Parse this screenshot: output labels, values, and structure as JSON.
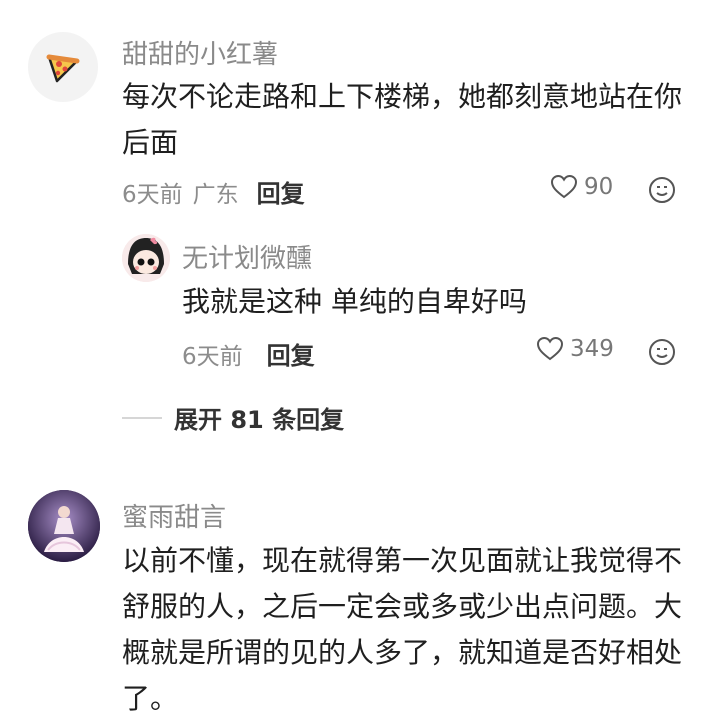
{
  "comments": [
    {
      "author": "甜甜的小红薯",
      "avatar_icon": "pizza-slice-icon",
      "text_lines": [
        "每次不论走路和上下楼梯，她都刻意地站在你",
        "后面"
      ],
      "time": "6天前",
      "location": "广东",
      "reply_label": "回复",
      "likes": "90",
      "reply": {
        "author": "无计划微醺",
        "avatar_icon": "cartoon-girl-avatar",
        "text": "我就是这种 单纯的自卑好吗",
        "time": "6天前",
        "reply_label": "回复",
        "likes": "349"
      },
      "expand_label": "展开 81 条回复"
    },
    {
      "author": "蜜雨甜言",
      "avatar_icon": "dancer-photo-avatar",
      "text_lines": [
        "以前不懂，现在就得第一次见面就让我觉得不",
        "舒服的人，之后一定会或多或少出点问题。大",
        "概就是所谓的见的人多了，就知道是否好相处",
        "了。"
      ]
    }
  ]
}
